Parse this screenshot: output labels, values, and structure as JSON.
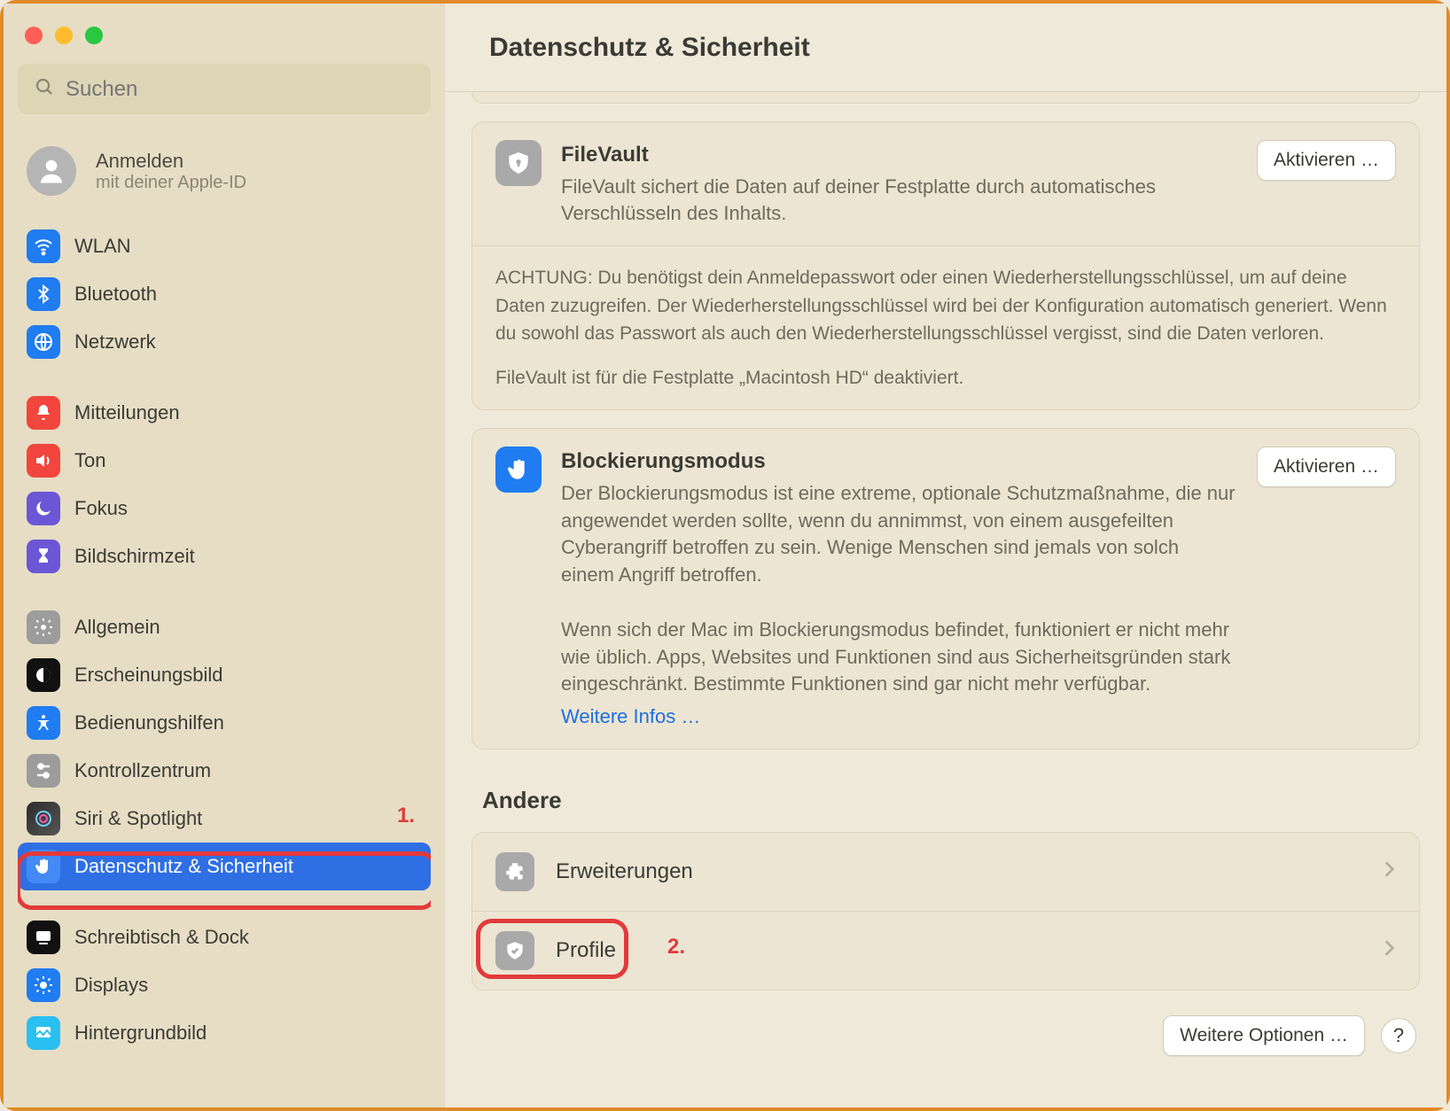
{
  "window": {
    "title": "Datenschutz & Sicherheit"
  },
  "search": {
    "placeholder": "Suchen"
  },
  "account": {
    "signin_title": "Anmelden",
    "signin_sub": "mit deiner Apple-ID"
  },
  "sidebar": {
    "groups": [
      [
        {
          "id": "wlan",
          "label": "WLAN",
          "color": "#1f7cf1"
        },
        {
          "id": "bluetooth",
          "label": "Bluetooth",
          "color": "#1f7cf1"
        },
        {
          "id": "network",
          "label": "Netzwerk",
          "color": "#1f7cf1"
        }
      ],
      [
        {
          "id": "notifications",
          "label": "Mitteilungen",
          "color": "#f2453d"
        },
        {
          "id": "sound",
          "label": "Ton",
          "color": "#f2453d"
        },
        {
          "id": "focus",
          "label": "Fokus",
          "color": "#6b57d6"
        },
        {
          "id": "screentime",
          "label": "Bildschirmzeit",
          "color": "#6b57d6"
        }
      ],
      [
        {
          "id": "general",
          "label": "Allgemein",
          "color": "#9c9c9c"
        },
        {
          "id": "appearance",
          "label": "Erscheinungsbild",
          "color": "#111"
        },
        {
          "id": "accessibility",
          "label": "Bedienungshilfen",
          "color": "#1f7cf1"
        },
        {
          "id": "controlcenter",
          "label": "Kontrollzentrum",
          "color": "#9c9c9c"
        },
        {
          "id": "siri",
          "label": "Siri & Spotlight",
          "color": "#222"
        },
        {
          "id": "privacy",
          "label": "Datenschutz & Sicherheit",
          "color": "#1f7cf1"
        }
      ],
      [
        {
          "id": "desktop",
          "label": "Schreibtisch & Dock",
          "color": "#111"
        },
        {
          "id": "displays",
          "label": "Displays",
          "color": "#1f7cf1"
        },
        {
          "id": "wallpaper",
          "label": "Hintergrundbild",
          "color": "#29bff1"
        }
      ]
    ]
  },
  "colors": {
    "accent": "#2f6fe4",
    "annotation": "#e23a3a"
  },
  "annotations": {
    "one": "1.",
    "two": "2."
  },
  "main": {
    "filevault": {
      "title": "FileVault",
      "desc": "FileVault sichert die Daten auf deiner Festplatte durch automatisches Verschlüsseln des Inhalts.",
      "button": "Aktivieren …",
      "warn": "ACHTUNG: Du benötigst dein Anmeldepasswort oder einen Wiederherstellungsschlüssel, um auf deine Daten zuzugreifen. Der Wiederherstellungsschlüssel wird bei der Konfiguration automatisch generiert. Wenn du sowohl das Passwort als auch den Wiederherstellungsschlüssel vergisst, sind die Daten verloren.",
      "status": "FileVault ist für die Festplatte „Macintosh HD“ deaktiviert."
    },
    "lockdown": {
      "title": "Blockierungsmodus",
      "button": "Aktivieren …",
      "p1": "Der Blockierungsmodus ist eine extreme, optionale Schutzmaßnahme, die nur angewendet werden sollte, wenn du annimmst, von einem ausgefeilten Cyberangriff betroffen zu sein. Wenige Menschen sind jemals von solch einem Angriff betroffen.",
      "p2": "Wenn sich der Mac im Blockierungsmodus befindet, funktioniert er nicht mehr wie üblich. Apps, Websites und Funktionen sind aus Sicherheitsgründen stark eingeschränkt. Bestimmte Funktionen sind gar nicht mehr verfügbar.",
      "more": "Weitere Infos …"
    },
    "other_section": "Andere",
    "other": {
      "extensions": "Erweiterungen",
      "profiles": "Profile"
    },
    "footer": {
      "more_options": "Weitere Optionen …",
      "help": "?"
    }
  }
}
